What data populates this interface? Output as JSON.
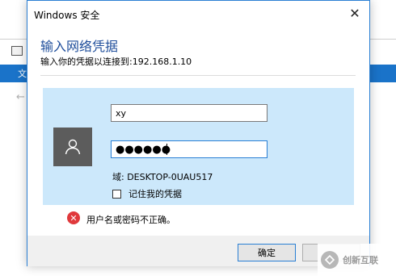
{
  "background_window": {
    "ribbon_tab": "文",
    "back_arrow": "←"
  },
  "dialog": {
    "title": "Windows 安全",
    "close_glyph": "✕",
    "heading": "输入网络凭据",
    "subtext": "输入你的凭据以连接到:192.168.1.10",
    "username_value": "xy",
    "password_value": "●●●●●●",
    "domain_label": "域: DESKTOP-0UAU517",
    "remember_label": "记住我的凭据",
    "error_message": "用户名或密码不正确。",
    "error_glyph": "✕",
    "ok_label": "确定"
  },
  "watermark": {
    "text": "创新互联"
  },
  "colors": {
    "accent": "#2a7fd4",
    "panel": "#cce8fb",
    "heading": "#1f4e9b",
    "error": "#e0393c",
    "ribbon": "#1a73c9"
  }
}
